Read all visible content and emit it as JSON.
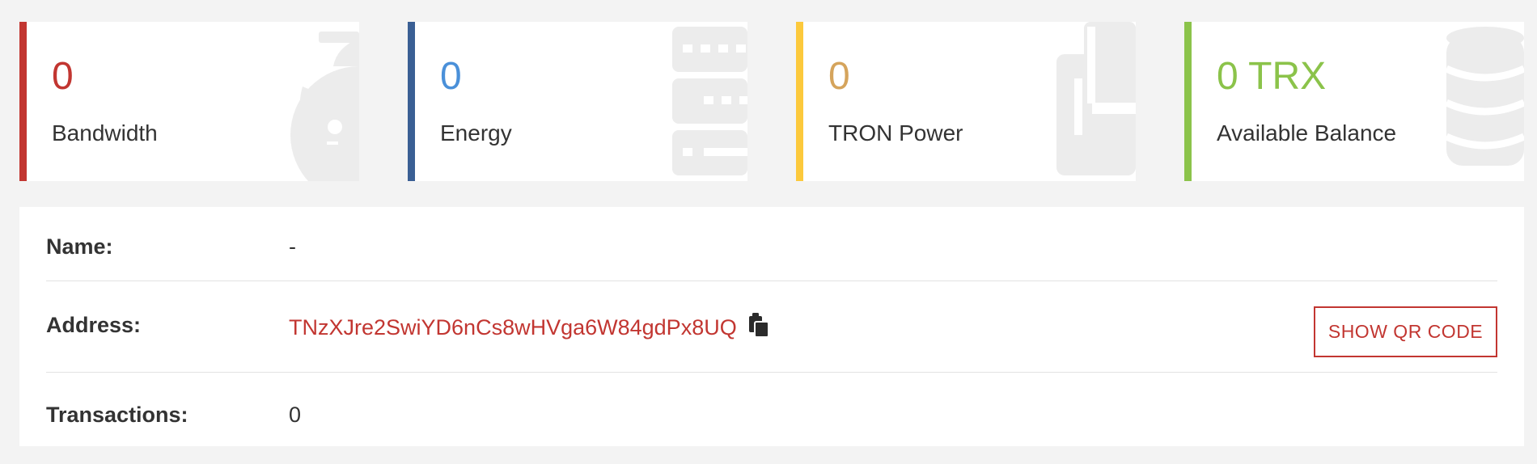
{
  "stats": [
    {
      "value": "0",
      "label": "Bandwidth",
      "accent": "#c23631",
      "icon": "pie-chart-icon"
    },
    {
      "value": "0",
      "label": "Energy",
      "accent": "#3a5f94",
      "value_color": "#4a90d9",
      "icon": "server-icon"
    },
    {
      "value": "0",
      "label": "TRON Power",
      "accent": "#fcc93c",
      "value_color": "#d5a45c",
      "icon": "bar-chart-icon"
    },
    {
      "value": "0 TRX",
      "label": "Available Balance",
      "accent": "#8bc34a",
      "value_color": "#8bc34a",
      "icon": "database-icon"
    }
  ],
  "details": {
    "name_label": "Name:",
    "name_value": "-",
    "address_label": "Address:",
    "address_value": "TNzXJre2SwiYD6nCs8wHVga6W84gdPx8UQ",
    "qr_button": "SHOW QR CODE",
    "transactions_label": "Transactions:",
    "transactions_value": "0"
  }
}
